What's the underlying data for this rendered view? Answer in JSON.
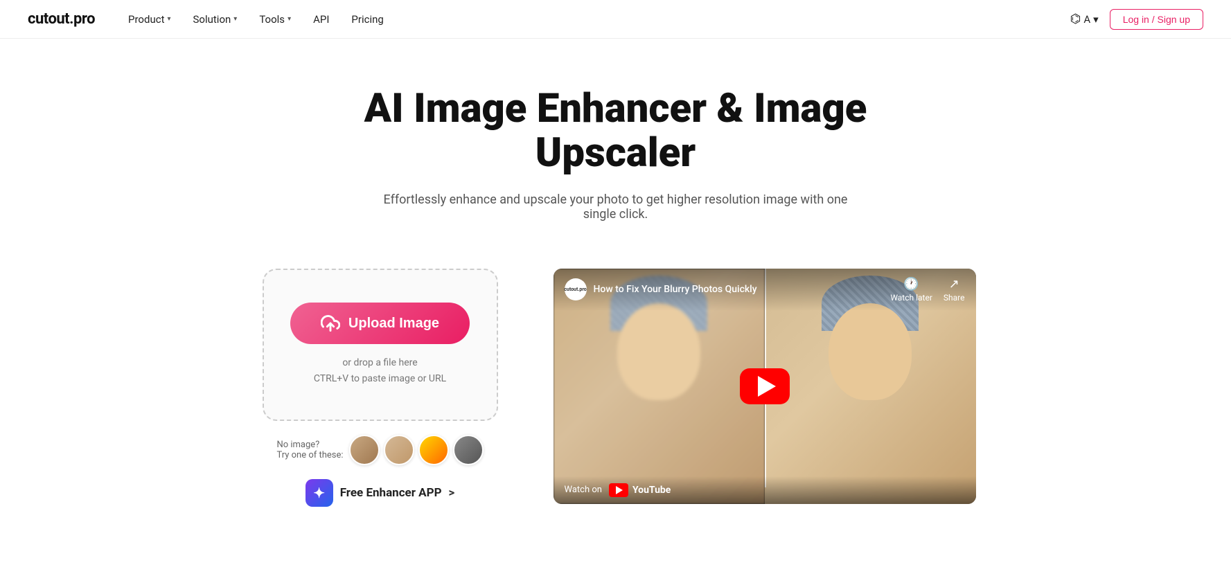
{
  "brand": {
    "name_prefix": "cutout",
    "name_suffix": ".pro"
  },
  "nav": {
    "links": [
      {
        "label": "Product",
        "has_dropdown": true
      },
      {
        "label": "Solution",
        "has_dropdown": true
      },
      {
        "label": "Tools",
        "has_dropdown": true
      },
      {
        "label": "API",
        "has_dropdown": false
      },
      {
        "label": "Pricing",
        "has_dropdown": false
      }
    ],
    "lang_label": "A",
    "login_label": "Log in / Sign up"
  },
  "hero": {
    "title": "AI Image Enhancer & Image Upscaler",
    "subtitle": "Effortlessly enhance and upscale your photo to get higher resolution image with one single click."
  },
  "upload": {
    "button_label": "Upload Image",
    "hint_line1": "or drop a file here",
    "hint_line2": "CTRL+V to paste image or URL",
    "sample_label_line1": "No image?",
    "sample_label_line2": "Try one of these:"
  },
  "app_link": {
    "label": "Free Enhancer APP",
    "arrow": ">"
  },
  "video": {
    "channel_name": "cutout.pro",
    "title": "How to Fix Your Blurry Photos Quickly",
    "watch_later_label": "Watch later",
    "share_label": "Share",
    "watch_on_label": "Watch on",
    "youtube_label": "YouTube"
  }
}
